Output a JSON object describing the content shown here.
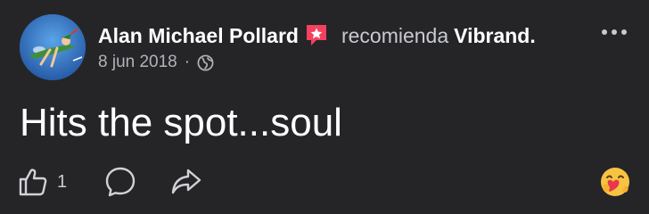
{
  "post": {
    "author": "Alan Michael Pollard",
    "recommends_text": "recomienda",
    "page_name": "Vibrand.",
    "date": "8 jun 2018",
    "separator": "·",
    "body": "Hits the spot...soul",
    "like_count": "1"
  },
  "icons": {
    "recommend": "recommend-star-icon",
    "privacy": "globe-icon",
    "more": "more-options-icon",
    "like": "thumbs-up-icon",
    "comment": "comment-bubble-icon",
    "share": "share-arrow-icon",
    "reaction": "care-emoji-icon"
  },
  "colors": {
    "background": "#252527",
    "primary_text": "#ffffff",
    "secondary_text": "#b0b3b8",
    "recommend_accent": "#f3425f"
  }
}
